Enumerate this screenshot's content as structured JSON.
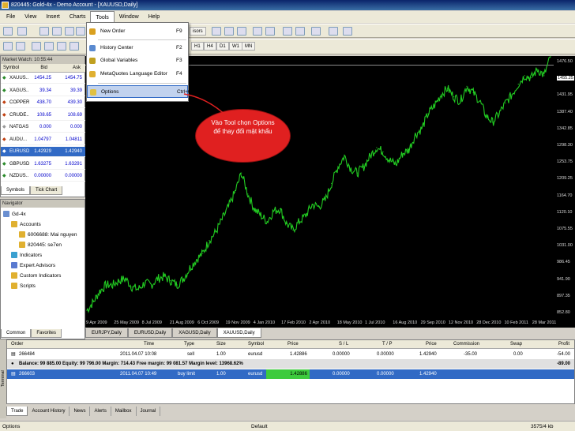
{
  "window": {
    "title": "820445: Gold-4x - Demo Account - [XAUUSD,Daily]"
  },
  "menubar": {
    "items": [
      "File",
      "View",
      "Insert",
      "Charts",
      "Tools",
      "Window",
      "Help"
    ]
  },
  "toolbar": {
    "advisors_label": "isors",
    "timeframes": [
      "H1",
      "H4",
      "D1",
      "W1",
      "MN"
    ]
  },
  "tools_menu": {
    "items": [
      {
        "label": "New Order",
        "shortcut": "F9",
        "icon": "new-order-icon",
        "color": "#d9a020"
      },
      {
        "label": "History Center",
        "shortcut": "F2",
        "icon": "history-center-icon",
        "color": "#5a8ad0"
      },
      {
        "label": "Global Variables",
        "shortcut": "F3",
        "icon": "global-variables-icon",
        "color": "#c0a020"
      },
      {
        "label": "MetaQuotes Language Editor",
        "shortcut": "F4",
        "icon": "metaeditor-icon",
        "color": "#e0b030"
      },
      {
        "label": "Options",
        "shortcut": "Ctrl+O",
        "icon": "options-icon",
        "color": "#e0c040"
      }
    ]
  },
  "callout": {
    "line1": "Vào Tool chọn Options",
    "line2": "để thay đổi mật khẩu"
  },
  "market_watch": {
    "title": "Market Watch: 10:55:44",
    "headers": [
      "Symbol",
      "Bid",
      "Ask"
    ],
    "rows": [
      {
        "symbol": "XAUUS..",
        "bid": "1454.25",
        "ask": "1454.75",
        "color": "#2a8a2a"
      },
      {
        "symbol": "XAGUS..",
        "bid": "39.34",
        "ask": "39.39",
        "color": "#2a8a2a"
      },
      {
        "symbol": "COPPER",
        "bid": "438.70",
        "ask": "439.30",
        "color": "#c04010"
      },
      {
        "symbol": "CRUDE..",
        "bid": "108.65",
        "ask": "108.69",
        "color": "#c04010"
      },
      {
        "symbol": "NATGAS",
        "bid": "0.000",
        "ask": "0.000",
        "color": "#999999"
      },
      {
        "symbol": "AUDU...",
        "bid": "1.04797",
        "ask": "1.04811",
        "color": "#c04010"
      },
      {
        "symbol": "EURUSD",
        "bid": "1.42929",
        "ask": "1.42940",
        "color": "#ffffff"
      },
      {
        "symbol": "GBPUSD",
        "bid": "1.63275",
        "ask": "1.63291",
        "color": "#2a8a2a"
      },
      {
        "symbol": "NZDUS..",
        "bid": "0.00000",
        "ask": "0.00000",
        "color": "#2a8a2a"
      }
    ],
    "tabs": [
      "Symbols",
      "Tick Chart"
    ]
  },
  "navigator": {
    "title": "Navigator",
    "items": [
      {
        "label": "Gd-4x",
        "indent": 0,
        "icon": "terminal-icon"
      },
      {
        "label": "Accounts",
        "indent": 1,
        "icon": "accounts-icon"
      },
      {
        "label": "6006688: Mai nguyen",
        "indent": 2,
        "icon": "account-icon"
      },
      {
        "label": "820445: se7en",
        "indent": 2,
        "icon": "account-icon"
      },
      {
        "label": "Indicators",
        "indent": 1,
        "icon": "indicators-icon"
      },
      {
        "label": "Expert Advisors",
        "indent": 1,
        "icon": "expert-advisors-icon"
      },
      {
        "label": "Custom Indicators",
        "indent": 1,
        "icon": "custom-indicators-icon"
      },
      {
        "label": "Scripts",
        "indent": 1,
        "icon": "scripts-icon"
      }
    ],
    "tabs": [
      "Common",
      "Favorites"
    ]
  },
  "chart_tabs": [
    "EURJPY,Daily",
    "EURUSD,Daily",
    "XAGUSD,Daily",
    "XAUUSD,Daily"
  ],
  "chart_data": {
    "type": "line",
    "title": "",
    "y_ticks": [
      "1476.50",
      "1455.25",
      "1431.95",
      "1387.40",
      "1342.85",
      "1298.30",
      "1253.75",
      "1209.25",
      "1164.70",
      "1120.10",
      "1075.55",
      "1031.00",
      "986.45",
      "941.90",
      "897.35",
      "852.80"
    ],
    "x_ticks": [
      "9 Apr 2009",
      "25 May 2009",
      "8 Jul 2009",
      "21 Aug 2009",
      "6 Oct 2009",
      "19 Nov 2009",
      "4 Jan 2010",
      "17 Feb 2010",
      "2 Apr 2010",
      "18 May 2010",
      "1 Jul 2010",
      "16 Aug 2010",
      "29 Sep 2010",
      "12 Nov 2010",
      "28 Dec 2010",
      "10 Feb 2011",
      "28 Mar 2011"
    ],
    "ylim": [
      852.8,
      1476.5
    ],
    "current_price": "1455.25",
    "series": [
      {
        "name": "XAUUSD,Daily",
        "color": "#22cc22",
        "values": [
          875,
          895,
          920,
          935,
          935,
          945,
          950,
          930,
          925,
          940,
          935,
          950,
          955,
          945,
          935,
          950,
          975,
          995,
          1010,
          1040,
          1060,
          1090,
          1120,
          1155,
          1200,
          1150,
          1115,
          1100,
          1085,
          1110,
          1115,
          1080,
          1065,
          1085,
          1100,
          1125,
          1120,
          1135,
          1175,
          1215,
          1240,
          1210,
          1200,
          1215,
          1240,
          1260,
          1250,
          1230,
          1220,
          1245,
          1255,
          1290,
          1305,
          1340,
          1360,
          1385,
          1400,
          1380,
          1370,
          1405,
          1390,
          1370,
          1335,
          1320,
          1340,
          1365,
          1385,
          1410,
          1430,
          1425,
          1445,
          1430,
          1475
        ]
      }
    ]
  },
  "terminal": {
    "headers": [
      "Order",
      "Time",
      "Type",
      "Size",
      "Symbol",
      "Price",
      "S / L",
      "T / P",
      "Price",
      "Commission",
      "Swap",
      "Profit"
    ],
    "rows": [
      {
        "order": "266484",
        "time": "2011.04.07 10:08",
        "type": "sell",
        "size": "1.00",
        "symbol": "eurusd",
        "price": "1.42886",
        "sl": "0.00000",
        "tp": "0.00000",
        "cur": "1.42940",
        "commission": "-35.00",
        "swap": "0.00",
        "profit": "-54.00"
      },
      {
        "order": "266603",
        "time": "2011.04.07 10:49",
        "type": "buy limit",
        "size": "1.00",
        "symbol": "eurusd",
        "price": "1.42886",
        "sl": "0.00000",
        "tp": "0.00000",
        "cur": "1.42940",
        "commission": "",
        "swap": "",
        "profit": ""
      }
    ],
    "balance_line": "Balance: 99 885.00  Equity: 99 796.00  Margin: 714.43  Free margin: 99 081.57  Margin level: 13968.62%",
    "balance_profit": "-89.00",
    "tabs": [
      "Trade",
      "Account History",
      "News",
      "Alerts",
      "Mailbox",
      "Journal"
    ],
    "side_label": "Terminal"
  },
  "statusbar": {
    "left": "Options",
    "profile": "Default",
    "traffic": "3575/4 kb"
  }
}
